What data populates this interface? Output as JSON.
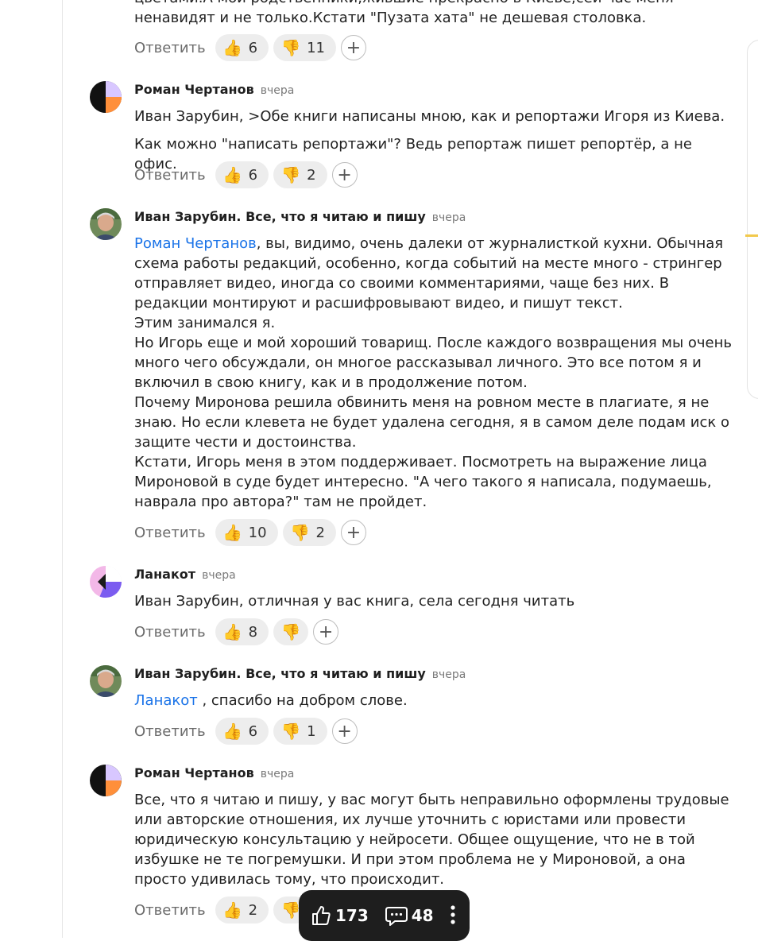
{
  "reply_label": "Ответить",
  "top_fragment": {
    "line1": "цветами.А мои родственники,жившие прекрасно в Киеве,сей час меня",
    "line2": "ненавидят и не только.Кстати \"Пузата хата\" не дешевая столовка.",
    "likes": "6",
    "dislikes": "11"
  },
  "comments": [
    {
      "author": "Роман Чертанов",
      "time": "вчера",
      "p1": "Иван Зарубин, >Обе книги написаны мною, как и репортажи Игоря из Киева.",
      "p2": "Как можно \"написать репортажи\"? Ведь репортаж пишет репортёр, а не офис.",
      "likes": "6",
      "dislikes": "2"
    },
    {
      "author": "Иван Зарубин. Все, что я читаю и пишу",
      "time": "вчера",
      "mention": "Роман Чертанов",
      "text": ", вы, видимо, очень далеки от журналисткой кухни. Обычная\nсхема работы редакций, особенно, когда событий на месте много - стрингер\nотправляет видео, иногда со своими комментариями, чаще без них. В\nредакции монтируют и расшифровывают видео, и пишут текст.\nЭтим занимался я.\nНо Игорь еще и мой хороший товарищ. После каждого возвращения мы очень\nмного чего обсуждали, он многое рассказывал личного. Это все потом я и\nвключил в свою книгу, как и в продолжение потом.\nПочему Миронова решила обвинить меня на ровном месте в плагиате, я не\nзнаю. Но если клевета не будет удалена сегодня, я в самом деле подам иск о\nзащите чести и достоинства.\nКстати, Игорь меня в этом поддерживает. Посмотреть на выражение лица\nМироновой в суде будет интересно. \"А чего такого я написала, подумаешь,\nнаврала про автора?\" там не пройдет.",
      "likes": "10",
      "dislikes": "2"
    },
    {
      "author": "Ланакот",
      "time": "вчера",
      "text": "Иван Зарубин, отличная у вас книга, села сегодня читать",
      "likes": "8"
    },
    {
      "author": "Иван Зарубин. Все, что я читаю и пишу",
      "time": "вчера",
      "mention": "Ланакот",
      "text": " , спасибо на добром слове.",
      "likes": "6",
      "dislikes": "1"
    },
    {
      "author": "Роман Чертанов",
      "time": "вчера",
      "text": "Все, что я читаю и пишу, у вас могут быть неправильно оформлены трудовые\nили авторские отношения, их лучше уточнить с юристами или провести\nюридическую консультацию у нейросети. Общее ощущение, что не в той\nизбушке не те погремушки. И при этом проблема не у Мироновой, а она\nпросто удивилась тому, что происходит.",
      "likes": "2"
    }
  ],
  "bottom_bar": {
    "likes": "173",
    "comments": "48"
  },
  "colors": {
    "mention": "#1a73e8",
    "bar_bg": "#1e1e1e",
    "pill_bg": "#ededed"
  }
}
